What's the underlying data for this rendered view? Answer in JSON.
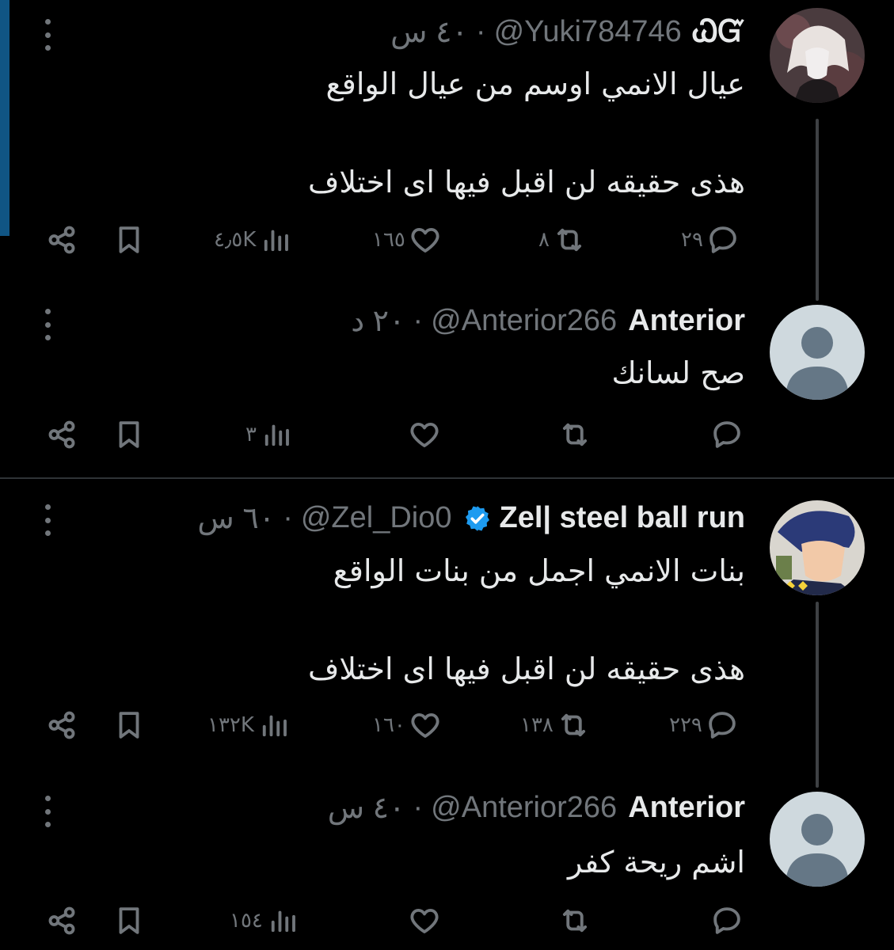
{
  "posts": [
    {
      "name": "ᏇᏳ",
      "handle": "@Yuki784746",
      "separator": "·",
      "time": "٤٠ س",
      "text": "عيال  الانمي اوسم  من عيال الواقع\n\nهذى حقيقه لن اقبل فيها اى اختلاف",
      "counts": {
        "replies": "٢٩",
        "reposts": "٨",
        "likes": "١٦٥",
        "views": "٤٫٥K"
      }
    },
    {
      "name": "Anterior",
      "handle": "@Anterior266",
      "separator": "·",
      "time": "٢٠ د",
      "text": "صح لسانك",
      "counts": {
        "replies": "",
        "reposts": "",
        "likes": "",
        "views": "٣"
      }
    },
    {
      "name": "Zel| steel ball run",
      "handle": "@Zel_Dio0",
      "separator": "·",
      "time": "٦٠ س",
      "verified": true,
      "text": "بنات الانمي اجمل من بنات الواقع\n\nهذى حقيقه لن اقبل فيها اى اختلاف",
      "counts": {
        "replies": "٢٢٩",
        "reposts": "١٣٨",
        "likes": "١٦٠",
        "views": "١٣٢K"
      }
    },
    {
      "name": "Anterior",
      "handle": "@Anterior266",
      "separator": "·",
      "time": "٤٠ س",
      "text": "اشم ريحة كفر",
      "counts": {
        "replies": "",
        "reposts": "",
        "likes": "",
        "views": "١٥٤"
      }
    }
  ],
  "icons": {
    "reply": "reply-icon",
    "repost": "repost-icon",
    "like": "heart-icon",
    "views": "views-icon",
    "bookmark": "bookmark-icon",
    "share": "share-icon",
    "more": "more-icon",
    "verified": "verified-badge-icon"
  },
  "colors": {
    "background": "#000000",
    "text": "#e7e9ea",
    "muted": "#71767b",
    "accent": "#1d9bf0"
  }
}
